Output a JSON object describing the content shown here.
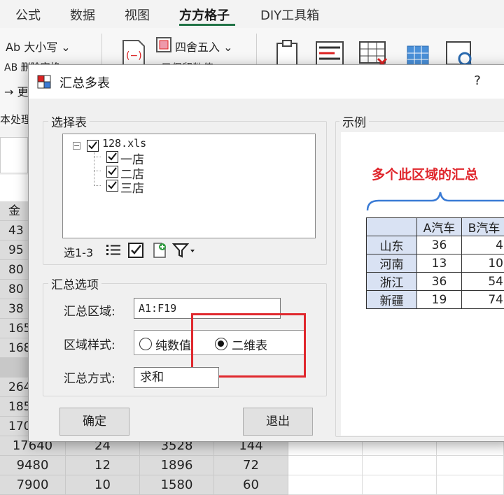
{
  "ribbon": {
    "tabs": [
      "公式",
      "数据",
      "视图",
      "方方格子",
      "DIY工具箱"
    ],
    "active_tab": "方方格子",
    "case_button": "Ab 大小写 ⌄",
    "round_button": "四舍五入 ⌄",
    "delete_partial": "AB 删除空格",
    "keep_values": "只保留数值",
    "arrow_item": "→ 更",
    "text_processing_label": "本处理"
  },
  "sheet": {
    "col_header_partial": "金",
    "left_values": [
      "43",
      "95",
      "80",
      "80",
      "38",
      "165",
      "168",
      "",
      "264",
      "185",
      "170"
    ],
    "bottom_rows": [
      [
        "17640",
        "24",
        "3528",
        "144"
      ],
      [
        "9480",
        "12",
        "1896",
        "72"
      ],
      [
        "7900",
        "10",
        "1580",
        "60"
      ]
    ]
  },
  "dialog": {
    "title": "汇总多表",
    "help_label": "?",
    "select_group_label": "选择表",
    "tree_root": "128.xls",
    "tree_children": [
      "一店",
      "二店",
      "三店"
    ],
    "toolbar_select_text": "选1-3",
    "options_group_label": "汇总选项",
    "range_label": "汇总区域:",
    "range_value": "A1:F19",
    "style_label": "区域样式:",
    "style_options": [
      "纯数值",
      "二维表"
    ],
    "style_selected": "二维表",
    "method_label": "汇总方式:",
    "method_value": "求和",
    "confirm_button": "确定",
    "exit_button": "退出",
    "example_group_label": "示例",
    "example": {
      "title": "多个此区域的汇总",
      "headers": [
        "",
        "A汽车",
        "B汽车"
      ],
      "rows": [
        [
          "山东",
          "36",
          "4"
        ],
        [
          "河南",
          "13",
          "10"
        ],
        [
          "浙江",
          "36",
          "54"
        ],
        [
          "新疆",
          "19",
          "74"
        ]
      ]
    }
  },
  "colors": {
    "highlight_red": "#e0282e",
    "header_fill": "#d9e2f3",
    "excel_green": "#217346"
  }
}
